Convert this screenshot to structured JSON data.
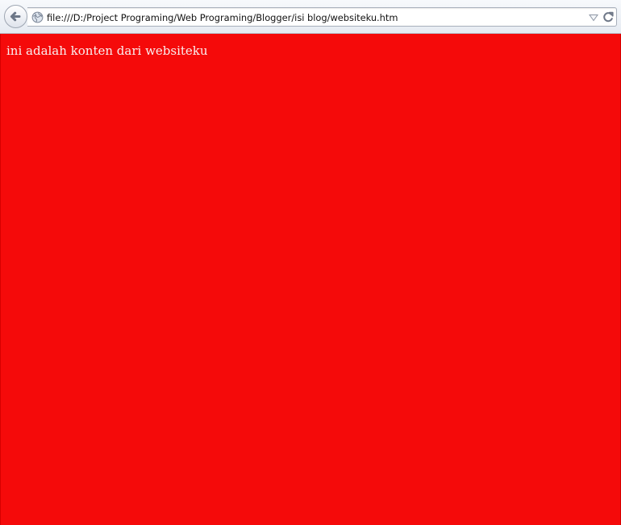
{
  "browser": {
    "toolbar": {
      "back_icon": "back-arrow-icon",
      "url": "file:///D:/Project Programing/Web Programing/Blogger/isi blog/websiteku.htm",
      "site_icon": "globe-icon",
      "dropdown_icon": "chevron-down-icon",
      "reload_icon": "reload-icon"
    },
    "content": {
      "text": "ini adalah konten dari websiteku",
      "background_color": "#f50a0a",
      "text_color": "#f9f0f0"
    }
  }
}
